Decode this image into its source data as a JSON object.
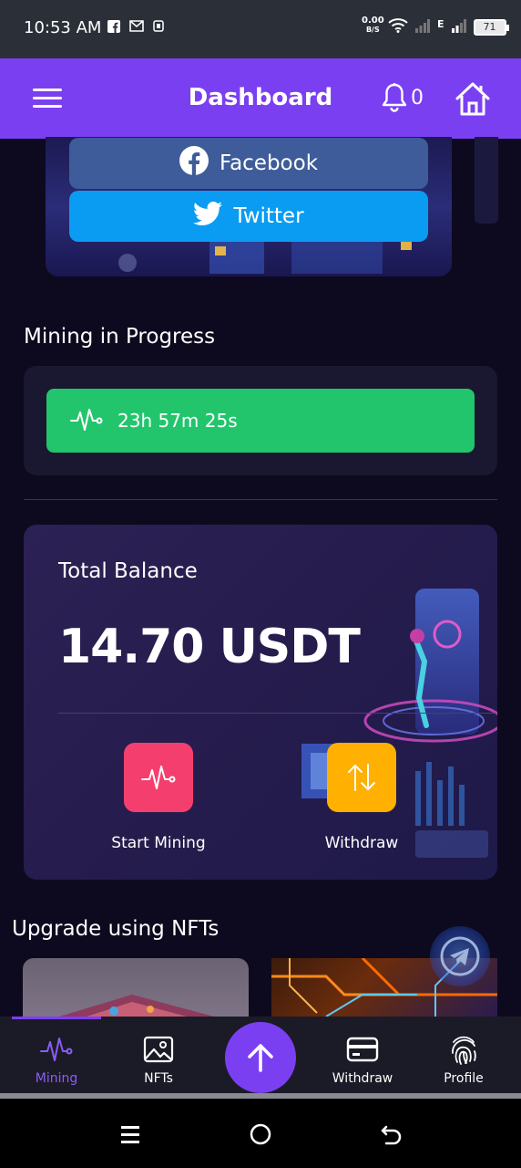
{
  "status_bar": {
    "time": "10:53 AM",
    "net_speed_value": "0.00",
    "net_speed_unit": "B/S",
    "network_type": "E",
    "battery": "71"
  },
  "header": {
    "title": "Dashboard",
    "notification_count": "0"
  },
  "social": {
    "facebook_label": "Facebook",
    "twitter_label": "Twitter"
  },
  "mining": {
    "section_title": "Mining in Progress",
    "timer": "23h 57m 25s"
  },
  "balance": {
    "label": "Total Balance",
    "value": "14.70 USDT"
  },
  "actions": {
    "start_mining": "Start Mining",
    "withdraw": "Withdraw"
  },
  "nfts": {
    "section_title": "Upgrade using NFTs"
  },
  "nav": {
    "mining": "Mining",
    "nfts": "NFTs",
    "withdraw": "Withdraw",
    "profile": "Profile"
  },
  "colors": {
    "primary": "#7b3ff2",
    "success": "#22c56c",
    "facebook": "#3f5c9a",
    "twitter": "#0a9cf2",
    "start_mining": "#f43f6e",
    "withdraw": "#ffb000"
  }
}
